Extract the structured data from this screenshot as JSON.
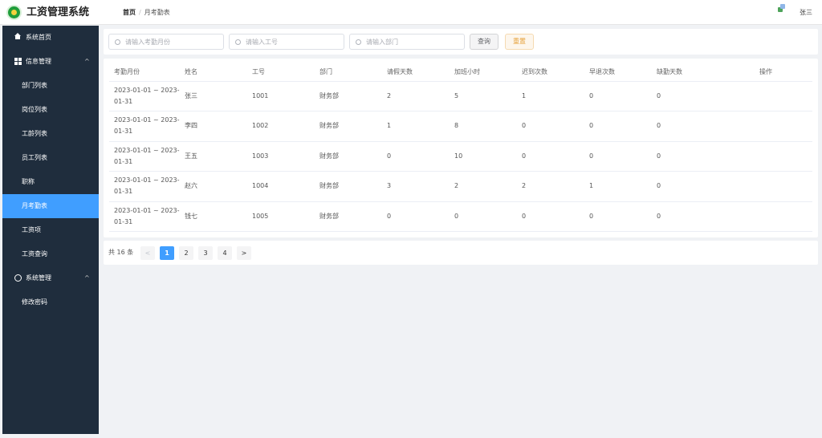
{
  "header": {
    "app_title": "工资管理系统",
    "breadcrumb": [
      "首页",
      "月考勤表"
    ],
    "breadcrumb_sep": "/",
    "user_name": "张三"
  },
  "sidebar": {
    "items": [
      {
        "label": "系统首页",
        "icon": "home-icon"
      },
      {
        "label": "信息管理",
        "icon": "grid-icon",
        "caret": "^"
      },
      {
        "label": "部门列表"
      },
      {
        "label": "岗位列表"
      },
      {
        "label": "工龄列表"
      },
      {
        "label": "员工列表"
      },
      {
        "label": "职称"
      },
      {
        "label": "月考勤表",
        "active": true
      },
      {
        "label": "工资项"
      },
      {
        "label": "工资查询"
      },
      {
        "label": "系统管理",
        "icon": "gear-icon",
        "caret": "^"
      },
      {
        "label": "修改密码"
      }
    ]
  },
  "search": {
    "month_placeholder": "请输入考勤月份",
    "empno_placeholder": "请输入工号",
    "dept_placeholder": "请输入部门",
    "query_label": "查询",
    "reset_label": "重置"
  },
  "table": {
    "columns": [
      "考勤月份",
      "姓名",
      "工号",
      "部门",
      "请假天数",
      "加班小时",
      "迟到次数",
      "早退次数",
      "缺勤天数",
      "操作"
    ],
    "rows": [
      [
        "2023-01-01 ~ 2023-01-31",
        "张三",
        "1001",
        "财务部",
        "2",
        "5",
        "1",
        "0",
        "0",
        ""
      ],
      [
        "2023-01-01 ~ 2023-01-31",
        "李四",
        "1002",
        "财务部",
        "1",
        "8",
        "0",
        "0",
        "0",
        ""
      ],
      [
        "2023-01-01 ~ 2023-01-31",
        "王五",
        "1003",
        "财务部",
        "0",
        "10",
        "0",
        "0",
        "0",
        ""
      ],
      [
        "2023-01-01 ~ 2023-01-31",
        "赵六",
        "1004",
        "财务部",
        "3",
        "2",
        "2",
        "1",
        "0",
        ""
      ],
      [
        "2023-01-01 ~ 2023-01-31",
        "钱七",
        "1005",
        "财务部",
        "0",
        "0",
        "0",
        "0",
        "0",
        ""
      ]
    ]
  },
  "pagination": {
    "total_text": "共 16 条",
    "prev": "<",
    "next": ">",
    "pages": [
      "1",
      "2",
      "3",
      "4"
    ],
    "current": "1"
  },
  "colors": {
    "sidebar_bg": "#1f2d3d",
    "active": "#409eff",
    "warning": "#e6a23c"
  }
}
